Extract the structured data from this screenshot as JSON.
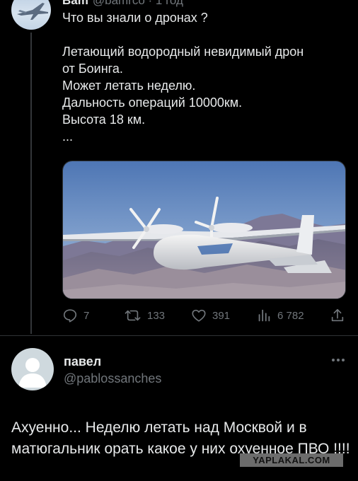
{
  "top_tweet": {
    "author_name": "Bam",
    "handle_and_time": "@bamrco · 1 год",
    "text_lines": [
      "Что вы знали о дронах ?",
      "",
      "Летающий водородный невидимый дрон",
      "от Боинга.",
      "Может летать неделю.",
      "Дальность операций 10000км.",
      "Высота 18 км.",
      "..."
    ],
    "photo_icon": "drone-photo",
    "actions": {
      "replies": "7",
      "reposts": "133",
      "likes": "391",
      "views": "6 782"
    }
  },
  "reply": {
    "name": "павел",
    "handle": "@pablossanches",
    "text": "Ахуенно... Неделю летать над Москвой и в матюгальник орать какое у них охуенное ПВО !!!!"
  },
  "watermark": "YAPLAKAL.COM",
  "colors": {
    "background": "#000000",
    "text": "#e7e9ea",
    "secondary": "#71767b",
    "divider": "#2f3336"
  }
}
